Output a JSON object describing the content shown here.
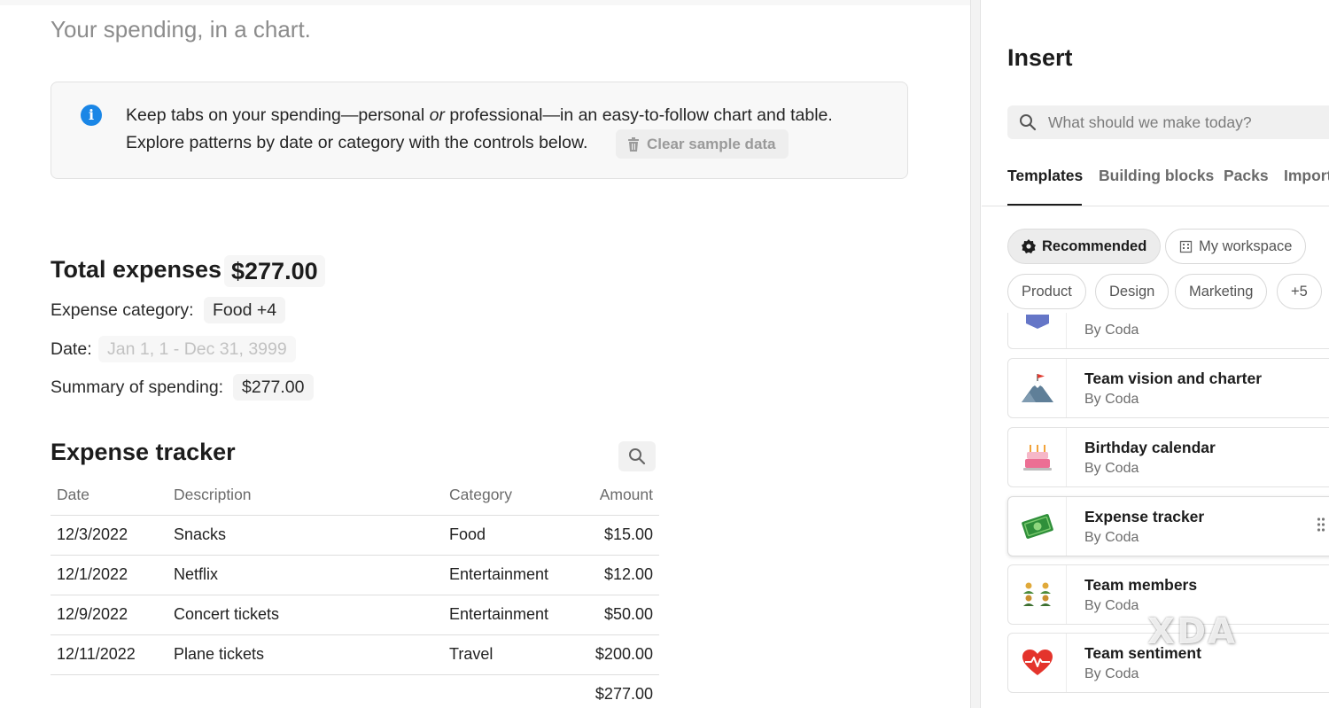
{
  "doc": {
    "subtitle": "Your spending, in a chart.",
    "callout": {
      "line1_a": "Keep tabs on your spending—personal ",
      "line1_em": "or",
      "line1_b": " professional—in an easy-to-follow chart and table.",
      "line2": "Explore patterns by date or category with the controls below.",
      "clear_button": "Clear sample data"
    },
    "total": {
      "label": "Total expenses",
      "value": "$277.00"
    },
    "filters": {
      "category_label": "Expense category:",
      "category_value": "Food +4",
      "date_label": "Date:",
      "date_value": "Jan 1, 1 - Dec 31, 3999",
      "summary_label": "Summary of spending:",
      "summary_value": "$277.00"
    },
    "tracker": {
      "title": "Expense tracker",
      "columns": {
        "date": "Date",
        "description": "Description",
        "category": "Category",
        "amount": "Amount"
      },
      "rows": [
        {
          "date": "12/3/2022",
          "description": "Snacks",
          "category": "Food",
          "amount": "$15.00"
        },
        {
          "date": "12/1/2022",
          "description": "Netflix",
          "category": "Entertainment",
          "amount": "$12.00"
        },
        {
          "date": "12/9/2022",
          "description": "Concert tickets",
          "category": "Entertainment",
          "amount": "$50.00"
        },
        {
          "date": "12/11/2022",
          "description": "Plane tickets",
          "category": "Travel",
          "amount": "$200.00"
        }
      ],
      "total": "$277.00"
    }
  },
  "panel": {
    "title": "Insert",
    "search_placeholder": "What should we make today?",
    "tabs": [
      "Templates",
      "Building blocks",
      "Packs",
      "Import"
    ],
    "pills": [
      "Recommended",
      "My workspace",
      "Product",
      "Design",
      "Marketing",
      "+5"
    ],
    "cards": [
      {
        "title": "",
        "by": "By Coda",
        "icon": "partial-icon"
      },
      {
        "title": "Team vision and charter",
        "by": "By Coda",
        "icon": "mountain-flag-icon"
      },
      {
        "title": "Birthday calendar",
        "by": "By Coda",
        "icon": "birthday-cake-icon"
      },
      {
        "title": "Expense tracker",
        "by": "By Coda",
        "icon": "money-icon"
      },
      {
        "title": "Team members",
        "by": "By Coda",
        "icon": "people-icon"
      },
      {
        "title": "Team sentiment",
        "by": "By Coda",
        "icon": "heart-pulse-icon"
      }
    ]
  },
  "watermark": "XDA",
  "colors": {
    "info_blue": "#1a86e6",
    "heart_red": "#e4342c",
    "money_green": "#2f8f3a"
  }
}
